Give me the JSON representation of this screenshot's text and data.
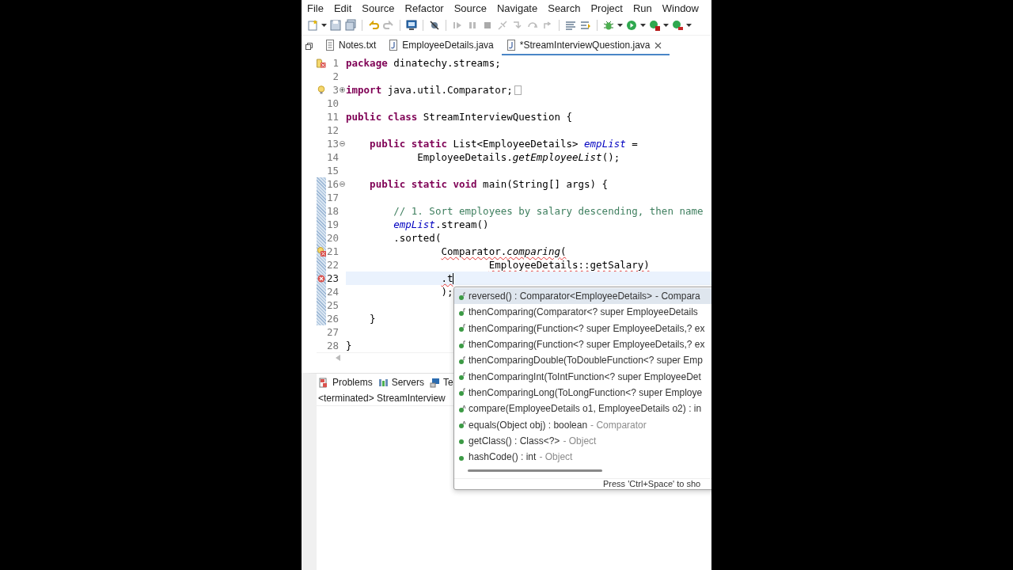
{
  "menu": [
    "File",
    "Edit",
    "Source",
    "Refactor",
    "Source",
    "Navigate",
    "Search",
    "Project",
    "Run",
    "Window"
  ],
  "editor_tabs": [
    {
      "label": "Notes.txt",
      "kind": "text",
      "selected": false
    },
    {
      "label": "EmployeeDetails.java",
      "kind": "java",
      "selected": false
    },
    {
      "label": "*StreamInterviewQuestion.java",
      "kind": "java",
      "selected": true
    }
  ],
  "code": [
    {
      "number": "1",
      "marker": {
        "kind": "bookmark-error"
      },
      "changed": false,
      "current": false,
      "tokens": [
        {
          "text": "package",
          "kind": "keyword",
          "error": false
        },
        {
          "text": " dinatechy.streams;",
          "kind": "plain",
          "error": false
        }
      ]
    },
    {
      "number": "2",
      "changed": false,
      "current": false
    },
    {
      "number": "3",
      "marker": {
        "kind": "warning"
      },
      "fold": {
        "kind": "expand"
      },
      "changed": false,
      "current": false,
      "folded": true,
      "tokens": [
        {
          "text": "import",
          "kind": "keyword",
          "error": false
        },
        {
          "text": " java.util.Comparator;",
          "kind": "plain",
          "error": false
        }
      ]
    },
    {
      "number": "10",
      "changed": false,
      "current": false
    },
    {
      "number": "11",
      "changed": false,
      "current": false,
      "tokens": [
        {
          "text": "public class",
          "kind": "keyword",
          "error": false
        },
        {
          "text": " StreamInterviewQuestion {",
          "kind": "plain",
          "error": false
        }
      ]
    },
    {
      "number": "12",
      "changed": false,
      "current": false
    },
    {
      "number": "13",
      "fold": {
        "kind": "collapse"
      },
      "changed": false,
      "current": false,
      "tokens": [
        {
          "text": "    public static",
          "kind": "keyword",
          "error": false
        },
        {
          "text": " List<EmployeeDetails> ",
          "kind": "plain",
          "error": false
        },
        {
          "text": "empList",
          "kind": "field",
          "error": false
        },
        {
          "text": " =",
          "kind": "plain",
          "error": false
        }
      ]
    },
    {
      "number": "14",
      "changed": false,
      "current": false,
      "tokens": [
        {
          "text": "            EmployeeDetails.",
          "kind": "plain",
          "error": false
        },
        {
          "text": "getEmployeeList",
          "kind": "static-method",
          "error": false
        },
        {
          "text": "();",
          "kind": "plain",
          "error": false
        }
      ]
    },
    {
      "number": "15",
      "changed": false,
      "current": false
    },
    {
      "number": "16",
      "fold": {
        "kind": "collapse"
      },
      "changed": true,
      "current": false,
      "tokens": [
        {
          "text": "    public static void",
          "kind": "keyword",
          "error": false
        },
        {
          "text": " main(String[] args) {",
          "kind": "plain",
          "error": false
        }
      ]
    },
    {
      "number": "17",
      "changed": true,
      "current": false
    },
    {
      "number": "18",
      "changed": true,
      "current": false,
      "tokens": [
        {
          "text": "        // 1. Sort employees by salary descending, then name",
          "kind": "comment",
          "error": false
        }
      ]
    },
    {
      "number": "19",
      "changed": true,
      "current": false,
      "tokens": [
        {
          "text": "        empList",
          "kind": "field",
          "error": false
        },
        {
          "text": ".stream()",
          "kind": "plain",
          "error": false
        }
      ]
    },
    {
      "number": "20",
      "changed": true,
      "current": false,
      "tokens": [
        {
          "text": "        .sorted(",
          "kind": "plain",
          "error": false
        }
      ]
    },
    {
      "number": "21",
      "marker": {
        "kind": "warning-error"
      },
      "changed": true,
      "current": false,
      "tokens": [
        {
          "text": "                Comparator.",
          "kind": "plain",
          "error": true
        },
        {
          "text": "comparing",
          "kind": "static-method",
          "error": true
        },
        {
          "text": "(",
          "kind": "plain",
          "error": true
        }
      ]
    },
    {
      "number": "22",
      "changed": true,
      "current": false,
      "tokens": [
        {
          "text": "                        EmployeeDetails::getSalary)",
          "kind": "plain",
          "error": true
        }
      ]
    },
    {
      "number": "23",
      "marker": {
        "kind": "error"
      },
      "changed": true,
      "current": true,
      "tokens": [
        {
          "text": "                .t",
          "kind": "plain",
          "error": true
        }
      ]
    },
    {
      "number": "24",
      "changed": true,
      "current": false,
      "tokens": [
        {
          "text": "                );",
          "kind": "plain",
          "error": false
        }
      ]
    },
    {
      "number": "25",
      "changed": true,
      "current": false
    },
    {
      "number": "26",
      "changed": true,
      "current": false,
      "tokens": [
        {
          "text": "    }",
          "kind": "plain",
          "error": false
        }
      ]
    },
    {
      "number": "27",
      "changed": false,
      "current": false
    },
    {
      "number": "28",
      "changed": false,
      "current": false,
      "tokens": [
        {
          "text": "}",
          "kind": "plain",
          "error": false
        }
      ]
    }
  ],
  "completion": {
    "items": [
      {
        "text": "reversed() : Comparator<EmployeeDetails>",
        "owner": "- Compara",
        "kind": "default",
        "selected": true
      },
      {
        "text": "thenComparing(Comparator<? super EmployeeDetails",
        "kind": "default",
        "selected": false
      },
      {
        "text": "thenComparing(Function<? super EmployeeDetails,? ex",
        "kind": "default",
        "selected": false
      },
      {
        "text": "thenComparing(Function<? super EmployeeDetails,? ex",
        "kind": "default",
        "selected": false
      },
      {
        "text": "thenComparingDouble(ToDoubleFunction<? super Emp",
        "kind": "default",
        "selected": false
      },
      {
        "text": "thenComparingInt(ToIntFunction<? super EmployeeDet",
        "kind": "default",
        "selected": false
      },
      {
        "text": "thenComparingLong(ToLongFunction<? super Employe",
        "kind": "default",
        "selected": false
      },
      {
        "text": "compare(EmployeeDetails o1, EmployeeDetails o2) : in",
        "kind": "abstract",
        "selected": false
      },
      {
        "text": "equals(Object obj) : boolean",
        "owner": "- Comparator",
        "kind": "abstract",
        "selected": false
      },
      {
        "text": "getClass() : Class<?>",
        "owner": "- Object",
        "kind": "public",
        "selected": false
      },
      {
        "text": "hashCode() : int",
        "owner": "- Object",
        "kind": "public",
        "selected": false
      }
    ],
    "footer": "Press 'Ctrl+Space' to sho"
  },
  "bottom_panel": {
    "tabs": [
      {
        "label": "Problems",
        "kind": "problems"
      },
      {
        "label": "Servers",
        "kind": "servers"
      },
      {
        "label": "Te",
        "kind": "terminal"
      }
    ],
    "console_label": "<terminated> StreamInterview"
  }
}
